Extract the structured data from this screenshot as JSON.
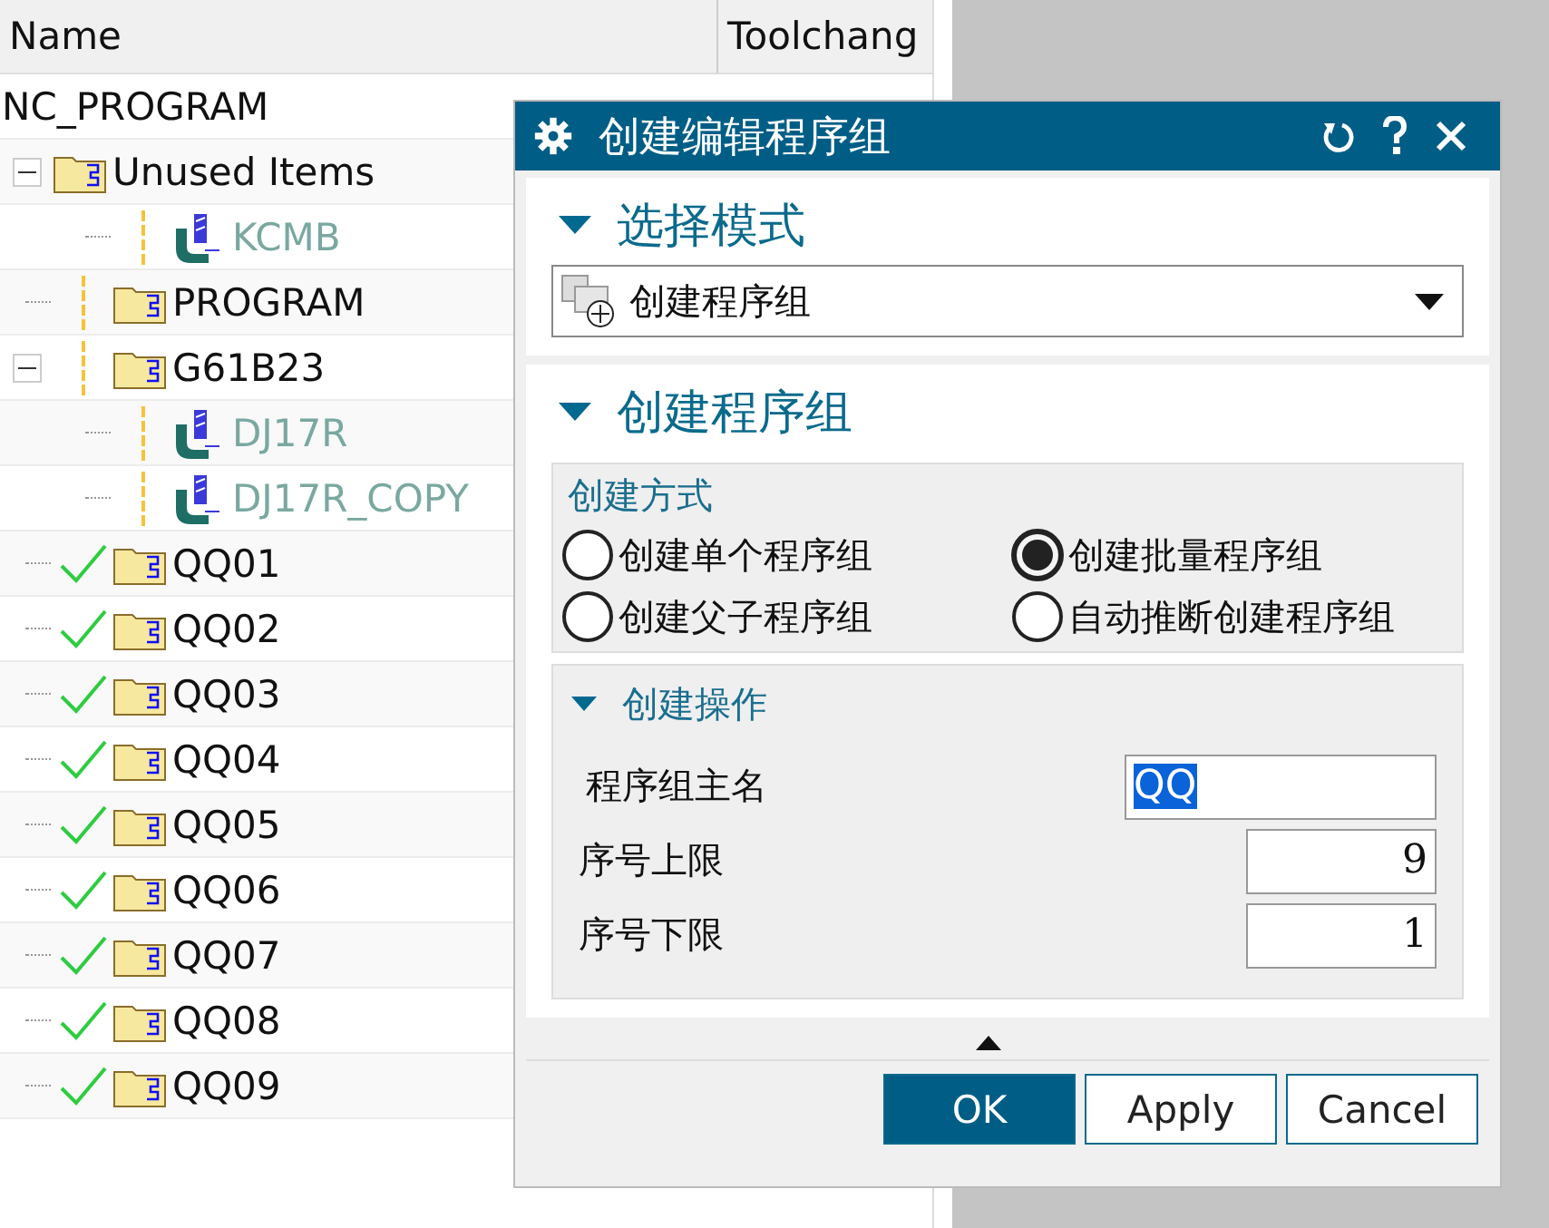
{
  "tree": {
    "columns": [
      "Name",
      "Toolchang"
    ],
    "items": [
      {
        "label": "NC_PROGRAM",
        "kind": "root",
        "children": [
          {
            "label": "Unused Items",
            "kind": "folder",
            "expanded": true,
            "children": [
              {
                "label": "KCMB",
                "kind": "operation",
                "complete": false
              }
            ]
          },
          {
            "label": "PROGRAM",
            "kind": "folder",
            "complete": false
          },
          {
            "label": "G61B23",
            "kind": "folder",
            "complete": false,
            "expanded": true,
            "children": [
              {
                "label": "DJ17R",
                "kind": "operation",
                "complete": false
              },
              {
                "label": "DJ17R_COPY",
                "kind": "operation",
                "complete": false
              }
            ]
          },
          {
            "label": "QQ01",
            "kind": "folder",
            "complete": true
          },
          {
            "label": "QQ02",
            "kind": "folder",
            "complete": true
          },
          {
            "label": "QQ03",
            "kind": "folder",
            "complete": true
          },
          {
            "label": "QQ04",
            "kind": "folder",
            "complete": true
          },
          {
            "label": "QQ05",
            "kind": "folder",
            "complete": true
          },
          {
            "label": "QQ06",
            "kind": "folder",
            "complete": true
          },
          {
            "label": "QQ07",
            "kind": "folder",
            "complete": true
          },
          {
            "label": "QQ08",
            "kind": "folder",
            "complete": true
          },
          {
            "label": "QQ09",
            "kind": "folder",
            "complete": true
          }
        ]
      }
    ]
  },
  "dialog": {
    "title": "创建编辑程序组",
    "select_section": {
      "title": "选择模式",
      "expanded": true,
      "dropdown_value": "创建程序组"
    },
    "create_section": {
      "title": "创建程序组",
      "expanded": true,
      "method_group": {
        "title": "创建方式",
        "options": [
          {
            "label": "创建单个程序组",
            "selected": false
          },
          {
            "label": "创建批量程序组",
            "selected": true
          },
          {
            "label": "创建父子程序组",
            "selected": false
          },
          {
            "label": "自动推断创建程序组",
            "selected": false
          }
        ]
      },
      "operation_group": {
        "title": "创建操作",
        "expanded": true,
        "fields": [
          {
            "label": "程序组主名",
            "kind": "text",
            "value": "QQ",
            "text_selected": true
          },
          {
            "label": "序号上限",
            "kind": "number",
            "value": "9",
            "text_selected": false
          },
          {
            "label": "序号下限",
            "kind": "number",
            "value": "1",
            "text_selected": false
          }
        ]
      }
    },
    "buttons": [
      {
        "label": "OK",
        "kind": "primary"
      },
      {
        "label": "Apply",
        "kind": "normal"
      },
      {
        "label": "Cancel",
        "kind": "normal"
      }
    ]
  }
}
